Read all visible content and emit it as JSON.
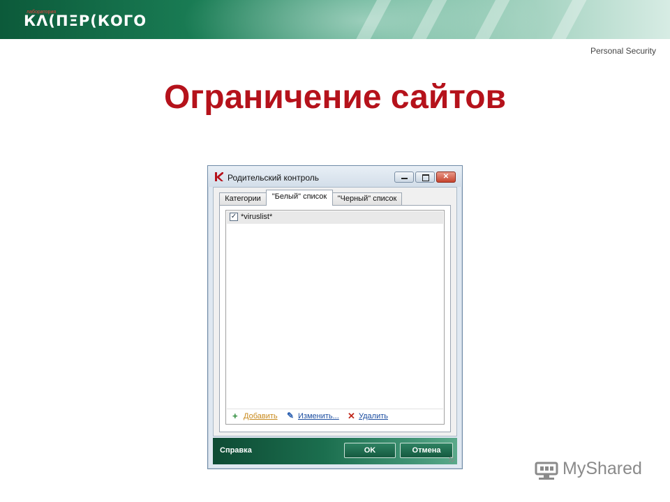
{
  "banner": {
    "logo_small": "лаборатория",
    "logo": "КΛ(ПΞР(КОГО"
  },
  "tagline": "Personal Security",
  "title": "Ограничение сайтов",
  "window": {
    "title": "Родительский контроль",
    "controls": {
      "minimize": "–",
      "maximize": "□",
      "close": "✕"
    },
    "tabs": [
      {
        "label": "Категории",
        "active": false
      },
      {
        "label": "\"Белый\" список",
        "active": true
      },
      {
        "label": "\"Черный\" список",
        "active": false
      }
    ],
    "list": [
      {
        "checked": true,
        "text": "*viruslist*"
      }
    ],
    "actions": {
      "add": "Добавить",
      "edit": "Изменить...",
      "delete": "Удалить"
    },
    "footer": {
      "help": "Справка",
      "ok": "OK",
      "cancel": "Отмена"
    }
  },
  "watermark": "MyShared",
  "icons": {
    "kaspersky": "kaspersky-k-icon",
    "add": "plus-icon",
    "edit": "pencil-icon",
    "delete": "x-icon"
  },
  "colors": {
    "title": "#b5121b",
    "banner": "#1a7d55",
    "footer": "#1b6e4e"
  }
}
